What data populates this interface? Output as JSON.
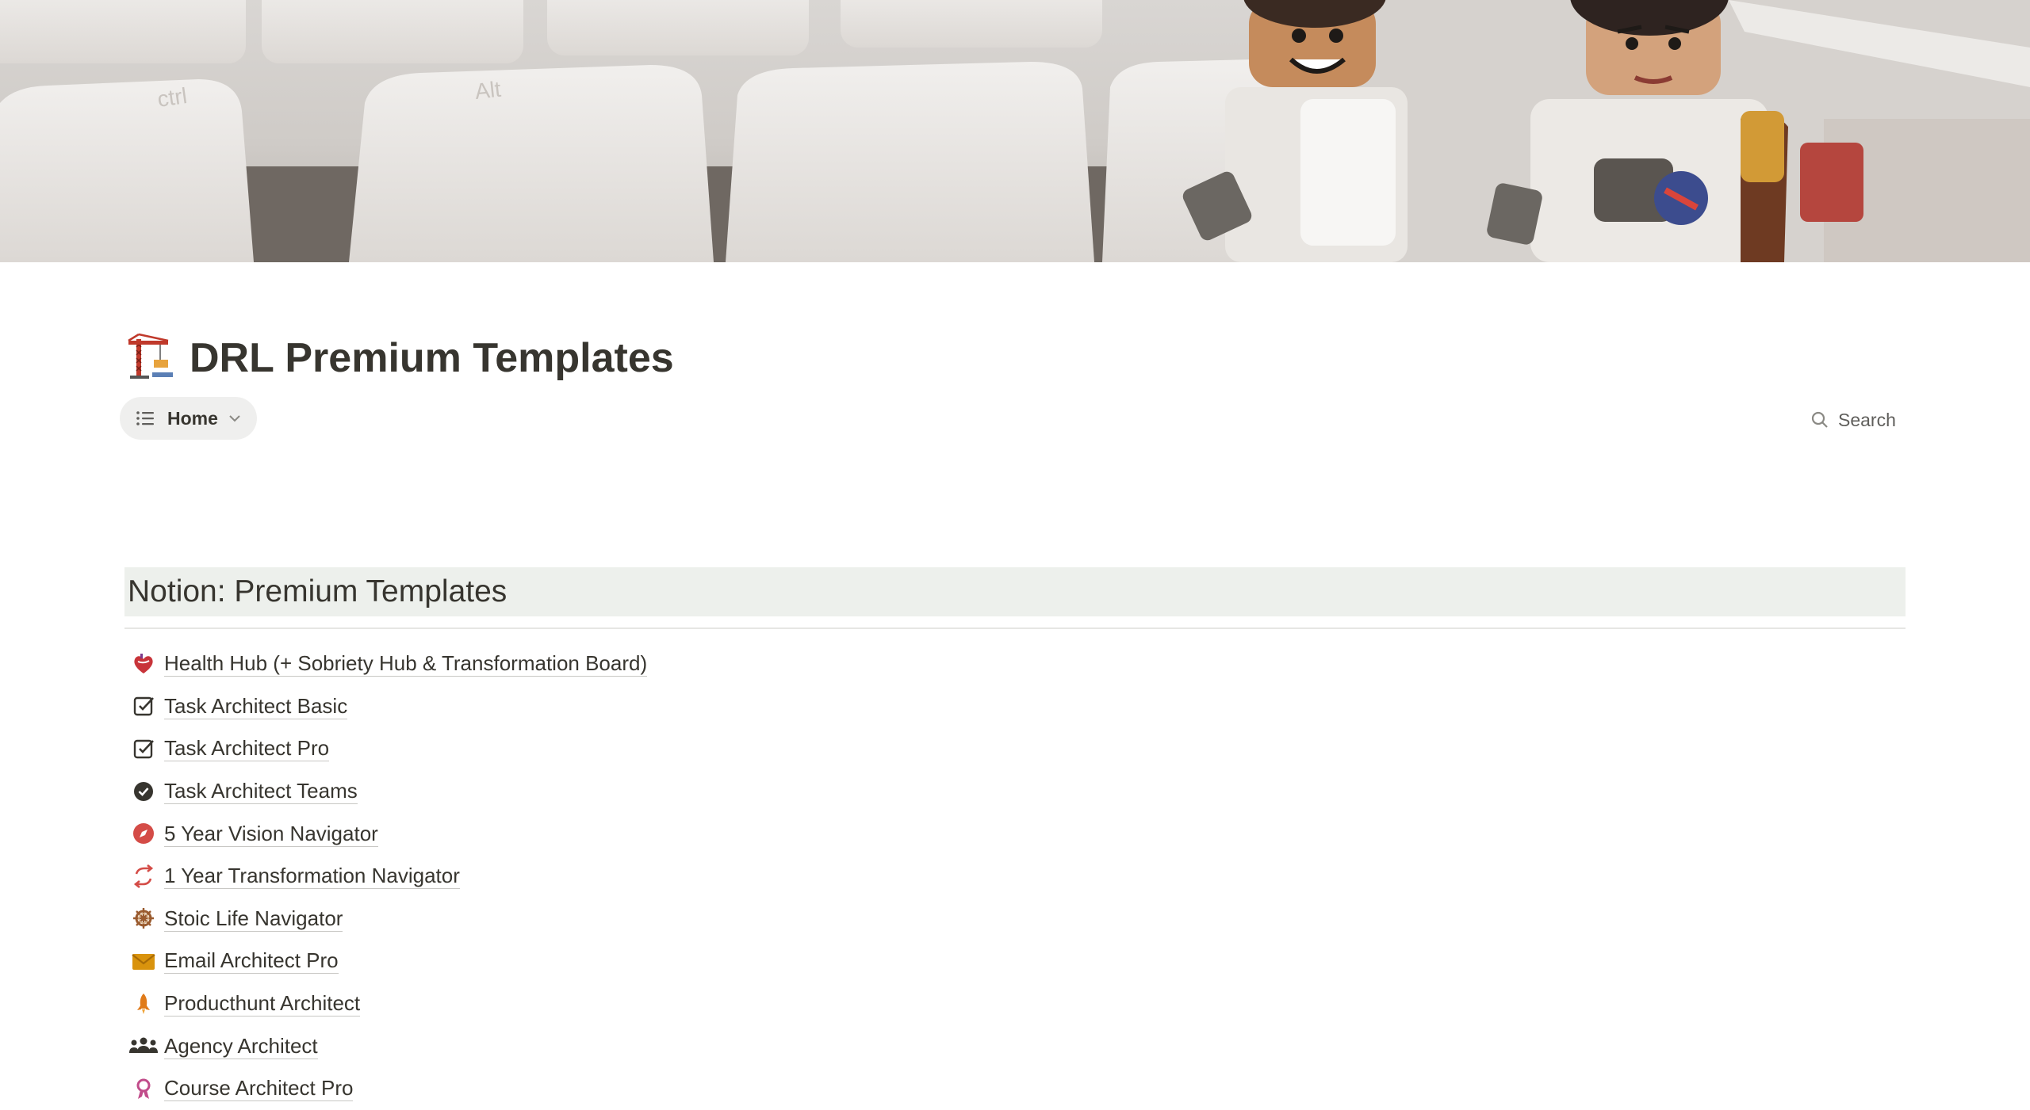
{
  "page": {
    "title": "DRL Premium Templates",
    "icon": "construction-crane-icon"
  },
  "views": {
    "active_tab_label": "Home",
    "tab_icon": "list-icon",
    "search_label": "Search"
  },
  "section": {
    "heading": "Notion: Premium Templates"
  },
  "links": [
    {
      "label": "Health Hub (+ Sobriety Hub & Transformation Board)",
      "icon": "anatomical-heart-icon"
    },
    {
      "label": "Task Architect Basic",
      "icon": "checkbox-icon"
    },
    {
      "label": "Task Architect Pro",
      "icon": "checkbox-icon"
    },
    {
      "label": "Task Architect Teams",
      "icon": "check-circle-icon"
    },
    {
      "label": "5 Year Vision Navigator",
      "icon": "compass-icon"
    },
    {
      "label": "1 Year Transformation Navigator",
      "icon": "arrows-cycle-icon"
    },
    {
      "label": "Stoic Life Navigator",
      "icon": "ship-wheel-icon"
    },
    {
      "label": "Email Architect Pro",
      "icon": "envelope-icon"
    },
    {
      "label": "Producthunt Architect",
      "icon": "rocket-icon"
    },
    {
      "label": "Agency Architect",
      "icon": "people-group-icon"
    },
    {
      "label": "Course Architect Pro",
      "icon": "ribbon-icon"
    }
  ],
  "colors": {
    "text": "#37352f",
    "heading_background": "#edf0ec",
    "tab_background": "#efefee"
  }
}
